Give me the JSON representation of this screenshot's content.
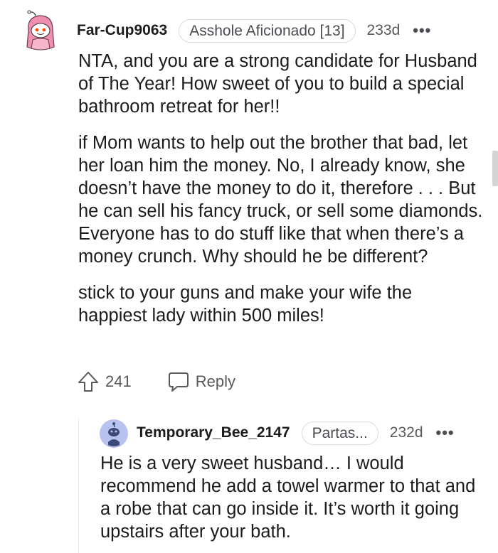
{
  "comment": {
    "username": "Far-Cup9063",
    "flair": "Asshole Aficionado [13]",
    "age": "233d",
    "more_label": "•••",
    "paragraphs": [
      "NTA, and you are a strong candidate for Husband of The Year! How sweet of you to build a special bathroom retreat for her!!",
      "if Mom wants to help out the brother that bad, let her loan him the money. No, I already know, she doesn’t have the money to do it, therefore . . . But he can sell his fancy truck, or sell some diamonds. Everyone has to do stuff like that when there’s a money crunch. Why should he be different?",
      "stick to your guns and make your wife the happiest lady within 500 miles!"
    ],
    "upvotes": "241",
    "reply_label": "Reply",
    "avatar_icon": "snoo-avatar-pink-hood-icon"
  },
  "reply": {
    "username": "Temporary_Bee_2147",
    "flair": "Partas...",
    "age": "232d",
    "more_label": "•••",
    "text": "He is a very sweet husband… I would recommend he add a towel warmer to that and a robe that can go inside it. It’s worth it going upstairs after your bath.",
    "avatar_icon": "snoo-avatar-blue-icon"
  },
  "colors": {
    "text": "#1c1c1c",
    "meta": "#57595d",
    "flair_border": "#d7d9db",
    "reply_avatar_bg": "#bac3f0",
    "pink_hood": "#f08fb0"
  }
}
